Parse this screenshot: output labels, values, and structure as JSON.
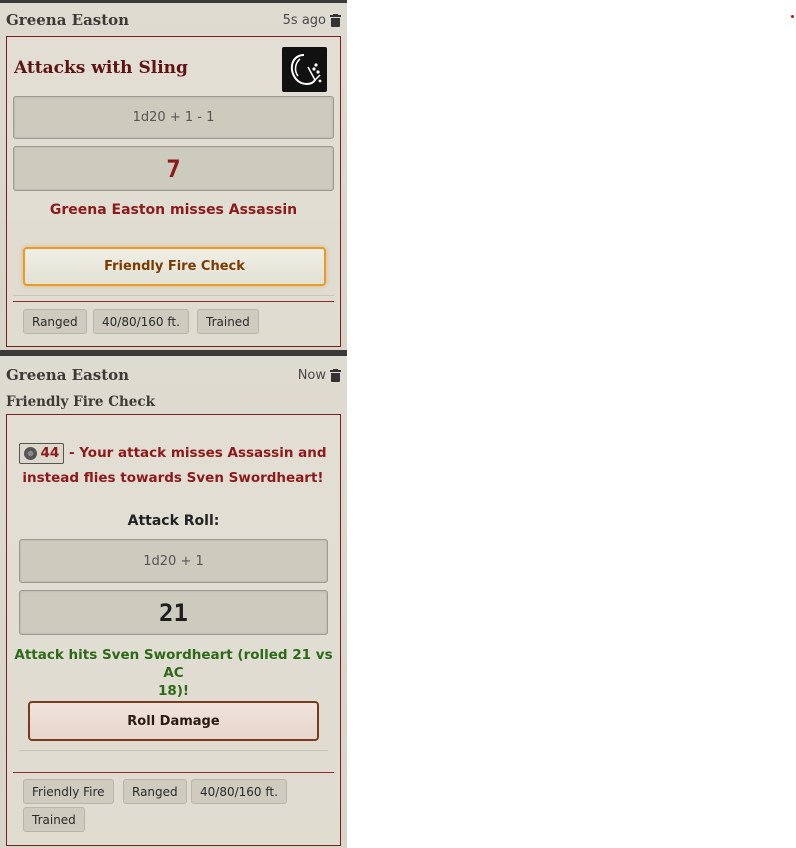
{
  "messages": [
    {
      "sender": "Greena Easton",
      "time": "5s ago",
      "title": "Attacks with Sling",
      "weapon_icon": "sling-icon",
      "formula": "1d20 + 1 - 1",
      "total": "7",
      "outcome": "Greena Easton misses Assassin",
      "button_label": "Friendly Fire Check",
      "tags": [
        "Ranged",
        "40/80/160 ft.",
        "Trained"
      ]
    },
    {
      "sender": "Greena Easton",
      "time": "Now",
      "flavor_header": "Friendly Fire Check",
      "inline_roll_value": "44",
      "flavor_text_1": " - Your attack misses Assassin and",
      "flavor_text_2": "instead flies towards Sven Swordheart!",
      "roll_label": "Attack Roll:",
      "formula": "1d20 + 1",
      "total": "21",
      "outcome_line_1": "Attack hits Sven Swordheart (rolled 21 vs AC",
      "outcome_line_2": "18)!",
      "button_label": "Roll Damage",
      "tags": [
        "Friendly Fire",
        "Ranged",
        "40/80/160 ft.",
        "Trained"
      ]
    }
  ],
  "colors": {
    "miss_red": "#8c1a1a",
    "hit_green": "#2d6a17",
    "title_red": "#5e1414",
    "button_orange": "#e89a2a"
  }
}
